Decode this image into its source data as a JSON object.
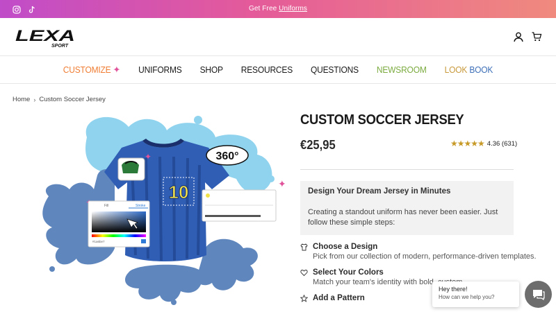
{
  "announcement": {
    "prefix": "Get Free",
    "link": "Uniforms",
    "social_icons": [
      "instagram-icon",
      "tiktok-icon"
    ]
  },
  "header": {
    "logo_main": "LEXA",
    "logo_sub": "SPORT",
    "icons": [
      "account-icon",
      "cart-icon"
    ]
  },
  "nav": {
    "items": [
      "CUSTOMIZE",
      "UNIFORMS",
      "SHOP",
      "RESOURCES",
      "QUESTIONS",
      "NEWSROOM",
      "LOOK",
      "BOOK"
    ]
  },
  "breadcrumb": {
    "home": "Home",
    "current": "Custom Soccer Jersey"
  },
  "product": {
    "title": "CUSTOM SOCCER JERSEY",
    "price": "€25,95",
    "stars": "★★★★★",
    "rating": "4.36 (631)",
    "promo_title": "Design Your Dream Jersey in Minutes",
    "promo_text": "Creating a standout uniform has never been easier. Just follow these simple steps:",
    "steps": [
      {
        "title": "Choose a Design",
        "desc": "Pick from our collection of modern, performance-driven templates.",
        "icon": "shirt-icon"
      },
      {
        "title": "Select Your Colors",
        "desc": "Match your team's identity with bold, custom",
        "icon": "heart-icon"
      },
      {
        "title": "Add a Pattern",
        "desc": "",
        "icon": "star-icon"
      }
    ]
  },
  "hero": {
    "badge_360": "360°",
    "jersey_number": "10",
    "panel_tab_1": "Fill",
    "panel_tab_2": "Stroke",
    "hex_value": "#1a6be7"
  },
  "chat": {
    "greeting": "Hey there!",
    "prompt": "How can we help you?"
  },
  "colors": {
    "accent_orange": "#f07d33",
    "accent_green": "#7bab3f",
    "accent_blue": "#3d6fb8",
    "star_gold": "#c79a28"
  }
}
